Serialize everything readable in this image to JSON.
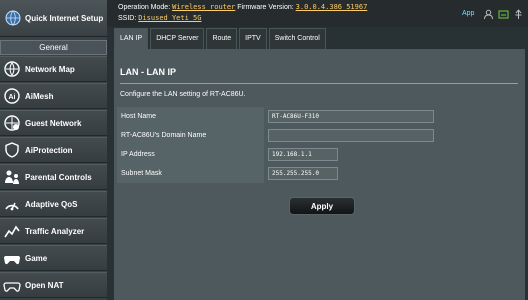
{
  "sidebar": {
    "quick_setup": "Quick Internet Setup",
    "section": "General",
    "items": [
      {
        "label": "Network Map",
        "icon": "network-map-icon"
      },
      {
        "label": "AiMesh",
        "icon": "aimesh-icon"
      },
      {
        "label": "Guest Network",
        "icon": "guest-network-icon"
      },
      {
        "label": "AiProtection",
        "icon": "aiprotection-icon"
      },
      {
        "label": "Parental Controls",
        "icon": "parental-controls-icon"
      },
      {
        "label": "Adaptive QoS",
        "icon": "adaptive-qos-icon"
      },
      {
        "label": "Traffic Analyzer",
        "icon": "traffic-analyzer-icon"
      },
      {
        "label": "Game",
        "icon": "game-icon"
      },
      {
        "label": "Open NAT",
        "icon": "open-nat-icon"
      }
    ]
  },
  "header": {
    "op_mode_label": "Operation Mode:",
    "op_mode_value": "Wireless router",
    "firmware_label": "Firmware Version:",
    "firmware_value": "3.0.0.4.386_51967",
    "ssid_label": "SSID:",
    "ssid_value": "Disused_Yeti_5G",
    "app_label": "App"
  },
  "tabs": [
    "LAN IP",
    "DHCP Server",
    "Route",
    "IPTV",
    "Switch Control"
  ],
  "main": {
    "title": "LAN - LAN IP",
    "description": "Configure the LAN setting of RT-AC86U.",
    "fields": [
      {
        "label": "Host Name",
        "value": "RT-AC86U-F310"
      },
      {
        "label": "RT-AC86U's Domain Name",
        "value": ""
      },
      {
        "label": "IP Address",
        "value": "192.168.1.1"
      },
      {
        "label": "Subnet Mask",
        "value": "255.255.255.0"
      }
    ],
    "apply_label": "Apply"
  },
  "colors": {
    "background": "#283134",
    "panel": "#4d595d",
    "link": "#ffcc66",
    "app_accent": "#7ed6ff"
  }
}
